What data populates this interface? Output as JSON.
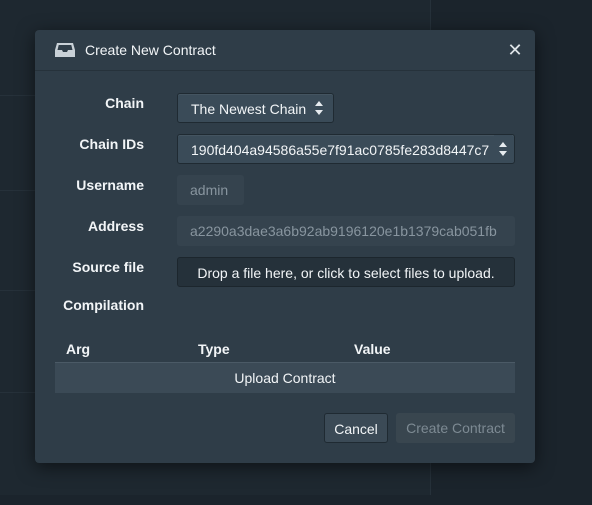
{
  "modal": {
    "title": "Create New Contract",
    "close_label": "✕"
  },
  "form": {
    "chain": {
      "label": "Chain",
      "value": "The Newest Chain"
    },
    "chain_ids": {
      "label": "Chain IDs",
      "value": "190fd404a94586a55e7f91ac0785fe283d8447c7"
    },
    "username": {
      "label": "Username",
      "value": "admin"
    },
    "address": {
      "label": "Address",
      "value": "a2290a3dae3a6b92ab9196120e1b1379cab051fb"
    },
    "source_file": {
      "label": "Source file",
      "dropzone_text": "Drop a file here, or click to select files to upload."
    },
    "compilation": {
      "label": "Compilation"
    }
  },
  "table": {
    "headers": [
      "Arg",
      "Type",
      "Value"
    ],
    "upload_label": "Upload Contract"
  },
  "footer": {
    "cancel_label": "Cancel",
    "create_label": "Create Contract"
  },
  "colors": {
    "modal_bg": "#2f3d48",
    "backdrop": "#1b242c",
    "text": "#f2f5f7",
    "muted": "#88959f"
  },
  "icons": {
    "header_icon": "inbox-tray-icon",
    "select_caret": "sort-caret-icon",
    "close": "close-icon"
  }
}
